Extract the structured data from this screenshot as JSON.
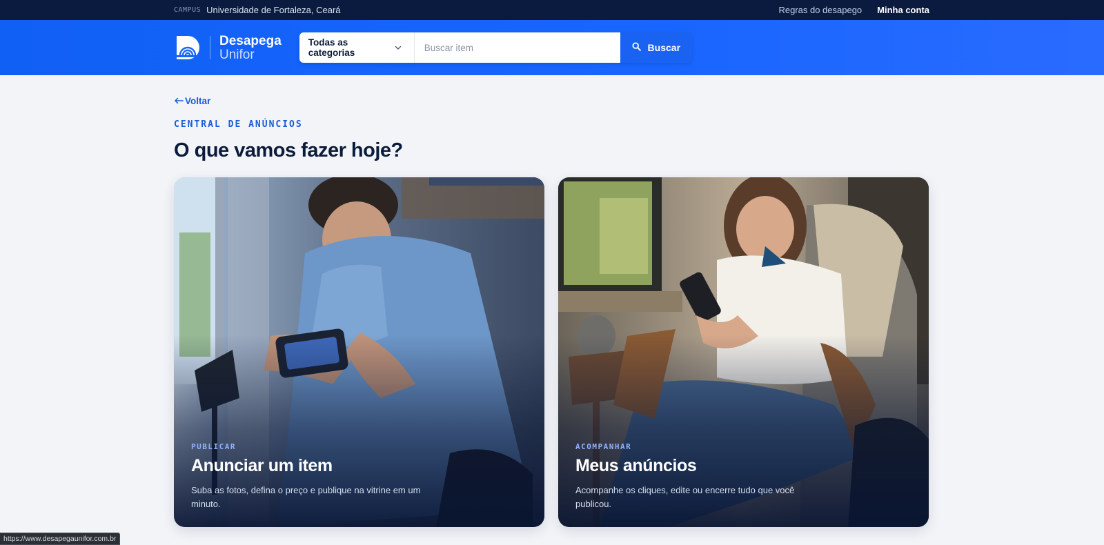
{
  "topbar": {
    "campus_tag": "CAMPUS",
    "campus_name": "Universidade de Fortaleza, Ceará",
    "links": [
      {
        "label": "Regras do desapego"
      },
      {
        "label": "Minha conta"
      }
    ]
  },
  "header": {
    "logo_line1": "Desapega",
    "logo_line2": "Unifor",
    "category_select": "Todas as categorias",
    "search_placeholder": "Buscar item",
    "search_button": "Buscar"
  },
  "main": {
    "back_label": "Voltar",
    "eyebrow": "CENTRAL DE ANÚNCIOS",
    "title": "O que vamos fazer hoje?",
    "cards": [
      {
        "tag": "PUBLICAR",
        "title": "Anunciar um item",
        "description": "Suba as fotos, defina o preço e publique na vitrine em um minuto."
      },
      {
        "tag": "ACOMPANHAR",
        "title": "Meus anúncios",
        "description": "Acompanhe os cliques, edite ou encerre tudo que você publicou."
      }
    ]
  },
  "statusbar": {
    "url": "https://www.desapegaunifor.com.br"
  },
  "colors": {
    "topbar": "#0a1b3f",
    "header_blue": "#1866ff",
    "accent": "#1a5bd8",
    "page_bg": "#f2f4f8"
  }
}
